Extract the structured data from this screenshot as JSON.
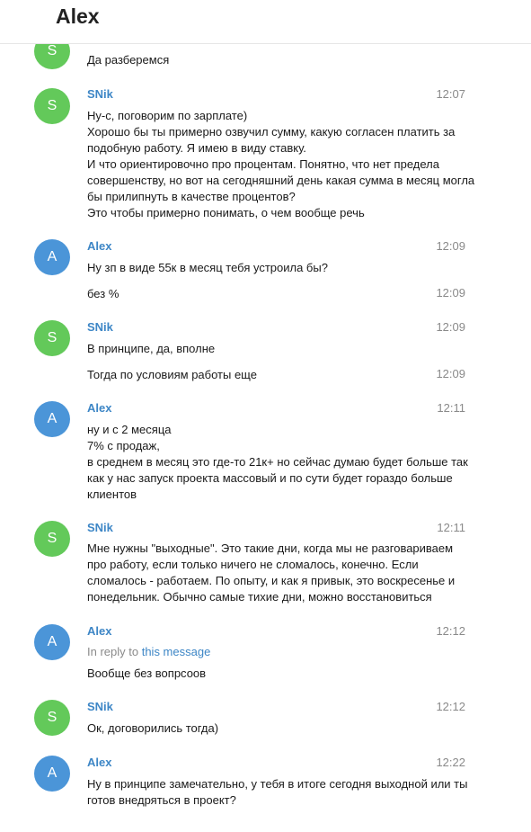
{
  "chat": {
    "title": "Alex"
  },
  "messages": [
    {
      "avatar": "S",
      "author": "",
      "time": "",
      "lines": [
        "Да разберемся"
      ]
    },
    {
      "avatar": "S",
      "author": "SNik",
      "time": "12:07",
      "lines": [
        "Ну-с, поговорим по зарплате)",
        "Хорошо бы ты примерно озвучил сумму, какую согласен платить за",
        "подобную работу. Я имею в виду ставку.",
        "И что ориентировочно про процентам. Понятно, что нет предела",
        "совершенству, но вот на сегодняшний день какая сумма в месяц могла",
        "бы прилипнуть в качестве процентов?",
        "Это чтобы примерно понимать, о чем вообще речь"
      ]
    },
    {
      "avatar": "A",
      "author": "Alex",
      "time": "12:09",
      "lines": [
        "Ну зп в виде 55к в месяц тебя устроила бы?"
      ]
    },
    {
      "avatar": "",
      "author": "",
      "time": "12:09",
      "lines": [
        "без %"
      ]
    },
    {
      "avatar": "S",
      "author": "SNik",
      "time": "12:09",
      "lines": [
        "В принципе, да, вполне"
      ]
    },
    {
      "avatar": "",
      "author": "",
      "time": "12:09",
      "lines": [
        "Тогда по условиям работы еще"
      ]
    },
    {
      "avatar": "A",
      "author": "Alex",
      "time": "12:11",
      "lines": [
        "ну и с 2 месяца",
        "7% с продаж,",
        "в среднем в месяц это где-то 21к+ но сейчас думаю будет больше так",
        "как у нас запуск проекта массовый и по сути будет гораздо больше",
        "клиентов"
      ]
    },
    {
      "avatar": "S",
      "author": "SNik",
      "time": "12:11",
      "lines": [
        "Мне нужны \"выходные\". Это такие дни, когда мы не разговариваем",
        "про работу, если только ничего не сломалось, конечно. Если",
        "сломалось - работаем. По опыту, и как я привык, это воскресенье и",
        "понедельник. Обычно самые тихие дни, можно восстановиться"
      ]
    },
    {
      "avatar": "A",
      "author": "Alex",
      "time": "12:12",
      "reply_prefix": "In reply to",
      "reply_link": "this message",
      "lines": [
        "Вообще без вопрсоов"
      ]
    },
    {
      "avatar": "S",
      "author": "SNik",
      "time": "12:12",
      "lines": [
        "Ок, договорились тогда)"
      ]
    },
    {
      "avatar": "A",
      "author": "Alex",
      "time": "12:22",
      "lines": [
        "Ну в принципе замечательно, у тебя в итоге сегодня выходной или ты",
        "готов внедряться в проект?"
      ]
    }
  ],
  "colors": {
    "accent": "#3d86c6",
    "avatar_s": "#63c95a",
    "avatar_a": "#4b95d8"
  }
}
